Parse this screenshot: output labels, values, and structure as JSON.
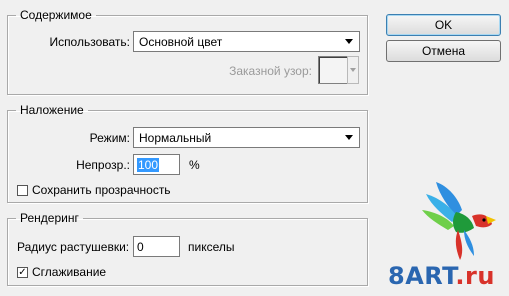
{
  "contents": {
    "legend": "Содержимое",
    "use_label": "Использовать:",
    "use_value": "Основной цвет",
    "custom_pattern_label": "Заказной узор:"
  },
  "blending": {
    "legend": "Наложение",
    "mode_label": "Режим:",
    "mode_value": "Нормальный",
    "opacity_label": "Непрозр.:",
    "opacity_value": "100",
    "opacity_unit": "%",
    "preserve_transparency_label": "Сохранить прозрачность",
    "preserve_transparency_checked": false
  },
  "rendering": {
    "legend": "Рендеринг",
    "feather_label": "Радиус растушевки:",
    "feather_value": "0",
    "feather_unit": "пикселы",
    "antialias_label": "Сглаживание",
    "antialias_checked": true,
    "antialias_mark": "✓"
  },
  "buttons": {
    "ok_label": "OK",
    "cancel_label": "Отмена"
  },
  "watermark": {
    "text_main": "8ART",
    "text_suffix": ".ru",
    "color_main": "#2a66b0",
    "color_suffix": "#d8322a"
  },
  "colors": {
    "dialog_bg": "#f0f0f0",
    "selection": "#3399ff"
  }
}
